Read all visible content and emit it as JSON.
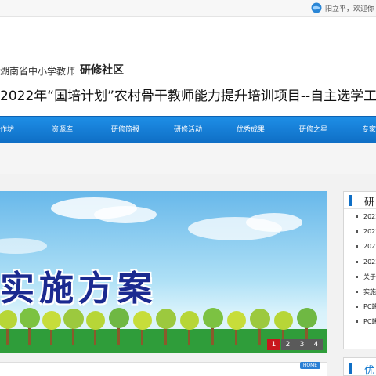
{
  "topbar": {
    "user_text": "阳立平，欢迎你"
  },
  "header": {
    "org": "湖南省中小学教师",
    "site": "研修社区",
    "project": "2022年“国培计划”农村骨干教师能力提升培训项目--自主选学工"
  },
  "nav": {
    "items": [
      "作坊",
      "资源库",
      "研修简报",
      "研修活动",
      "优秀成果",
      "研修之星",
      "专家"
    ]
  },
  "banner": {
    "title": "实施方案",
    "pages": [
      "1",
      "2",
      "3",
      "4"
    ],
    "active_page": "1"
  },
  "home_badge": "HOME",
  "side_panel": {
    "title": "研",
    "items": [
      "2022",
      "2022",
      "2022",
      "2022",
      "关于",
      "实施",
      "PC端",
      "PC端"
    ]
  },
  "side_panel2": {
    "title": "优"
  }
}
